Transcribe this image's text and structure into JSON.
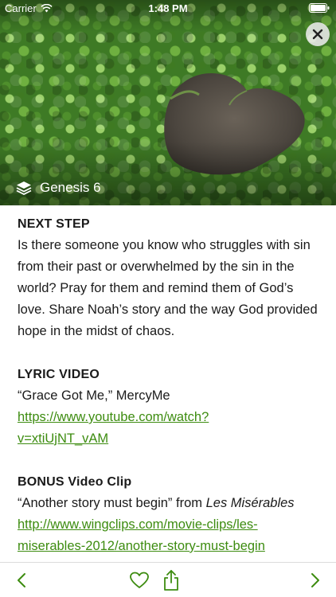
{
  "status_bar": {
    "carrier": "Carrier",
    "time": "1:48 PM"
  },
  "hero": {
    "chapter": "Genesis 6",
    "icons": [
      "layers-icon",
      "close-icon"
    ]
  },
  "sections": {
    "next_step": {
      "title": "NEXT STEP",
      "body": "Is there someone you know who struggles with sin from their past or overwhelmed by the sin in the world? Pray for them and remind them of God’s love. Share Noah’s story and the way God provided hope in the midst of chaos."
    },
    "lyric_video": {
      "title": "LYRIC VIDEO",
      "caption": "“Grace Got Me,” MercyMe",
      "link_line1": "https://www.youtube.com/watch?",
      "link_line2": "v=xtiUjNT_vAM"
    },
    "bonus_clip": {
      "title": "BONUS Video Clip",
      "caption_prefix": "“Another story must begin” from ",
      "caption_italic": "Les Misérables",
      "link_line1": "http://www.wingclips.com/movie-clips/les-",
      "link_line2": "miserables-2012/another-story-must-begin"
    }
  },
  "toolbar": {
    "icons": [
      "chevron-left-icon",
      "heart-icon",
      "share-icon",
      "chevron-right-icon"
    ]
  },
  "colors": {
    "accent": "#3d8c10",
    "text": "#1a1a1a"
  }
}
